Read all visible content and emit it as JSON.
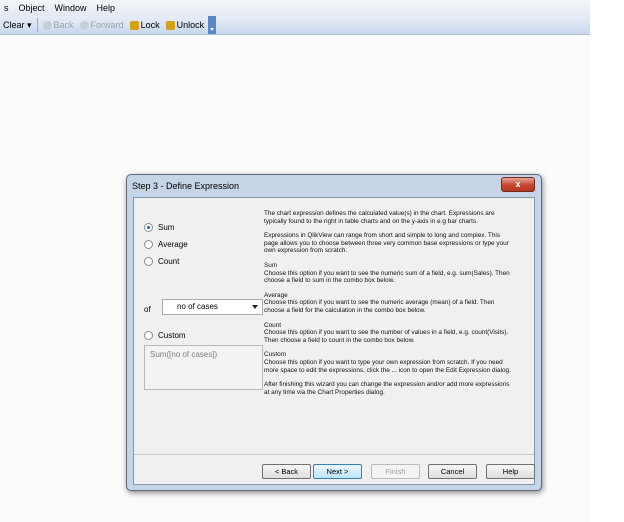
{
  "menubar": {
    "items": [
      "s",
      "Object",
      "Window",
      "Help"
    ]
  },
  "toolbar": {
    "clear": "Clear ▾",
    "back": "Back",
    "forward": "Forward",
    "lock": "Lock",
    "unlock": "Unlock"
  },
  "dialog": {
    "title": "Step 3 - Define Expression",
    "close_glyph": "x",
    "options": [
      "Sum",
      "Average",
      "Count",
      "Custom"
    ],
    "selected_option": "Sum",
    "of_label": "of",
    "field_combo_value": "no of cases",
    "custom_expression": "Sum([no of cases])",
    "help": {
      "intro": "The chart expression defines the calculated value(s) in the chart. Expressions are typically found to the right in table charts and on the y-axis in e.g bar charts.",
      "range": "Expressions in QlikView can range from short and simple to long and complex. This page allows you to choose between three very common base expressions or type your own expression from scratch.",
      "sum_title": "Sum",
      "sum_text": "Choose this option if you want to see the numeric sum of a field, e.g. sum(Sales). Then choose a field to sum in the combo box below.",
      "avg_title": "Average",
      "avg_text": "Choose this option if you want to see the numeric average (mean) of a field. Then choose a field for the calculation in the combo box below.",
      "count_title": "Count",
      "count_text": "Choose this option if you want to see the number of values in a field, e.g. count(Visits). Then choose a field to count in the combo box below.",
      "custom_title": "Custom",
      "custom_text": "Choose this option if you want to type your own expression from scratch. If you need more space to edit the expressions, click the ... icon to open the Edit Expression dialog.",
      "outro": "After finishing this wizard you can change the expression and/or add more expressions at any time via the Chart Properties dialog."
    },
    "buttons": {
      "back": "< Back",
      "next": "Next >",
      "finish": "Finish",
      "cancel": "Cancel",
      "help": "Help"
    }
  }
}
